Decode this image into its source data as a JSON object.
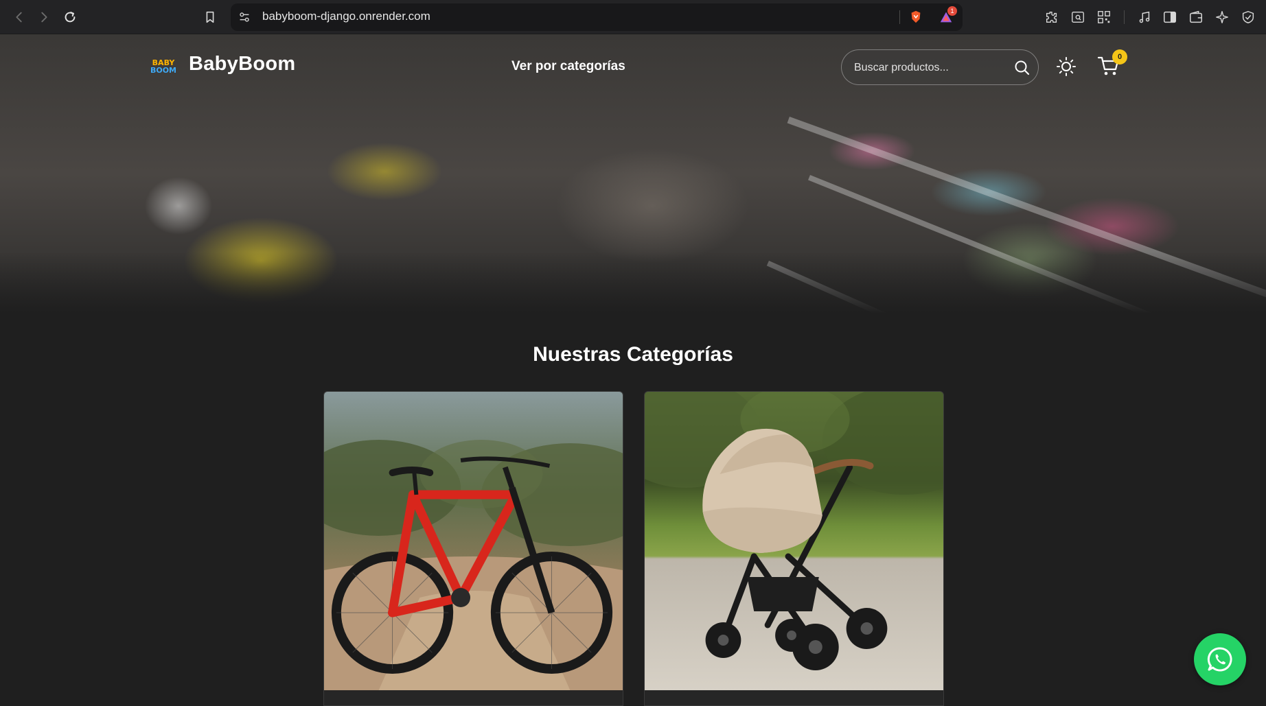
{
  "browser": {
    "url": "babyboom-django.onrender.com",
    "notification_count": "1"
  },
  "header": {
    "logo_lines": [
      "BABY",
      "BOOM"
    ],
    "brand": "BabyBoom",
    "nav_link": "Ver por categorías",
    "search_placeholder": "Buscar productos...",
    "cart_count": "0"
  },
  "main": {
    "section_title": "Nuestras Categorías",
    "categories": [
      {
        "image": "red-bicycle-photo"
      },
      {
        "image": "beige-stroller-photo"
      }
    ]
  },
  "icons": {
    "back": "arrow-left-icon",
    "forward": "arrow-right-icon",
    "reload": "reload-icon",
    "bookmark": "bookmark-icon",
    "site_settings": "site-settings-icon",
    "brave_shield": "brave-shield-icon",
    "brave_rewards": "brave-rewards-icon",
    "extensions": "puzzle-icon",
    "search_page": "page-search-icon",
    "qr": "qr-code-icon",
    "media": "music-note-icon",
    "sidebar": "sidebar-icon",
    "wallet": "wallet-icon",
    "leo": "ai-sparkle-icon",
    "vpn": "vpn-shield-icon",
    "search": "search-icon",
    "theme": "sun-icon",
    "cart": "cart-icon",
    "whatsapp": "whatsapp-icon"
  },
  "colors": {
    "page_background": "#1f1f1f",
    "cart_badge": "#f5c518",
    "whatsapp": "#25d366"
  }
}
